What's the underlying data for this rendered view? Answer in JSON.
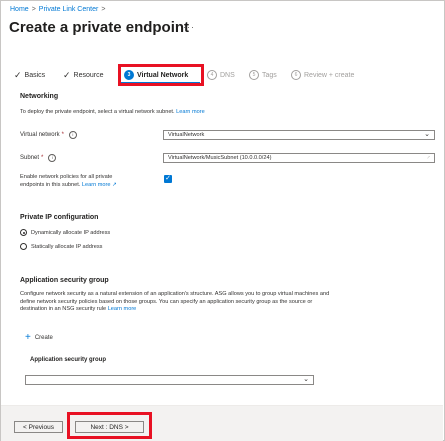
{
  "breadcrumb": {
    "home": "Home",
    "sep": ">",
    "private_link_center": "Private Link Center"
  },
  "page": {
    "title": "Create a private endpoint",
    "more": "···"
  },
  "tabs": [
    {
      "label": "Basics",
      "marker": "✓",
      "state": "done"
    },
    {
      "label": "Resource",
      "marker": "✓",
      "state": "done"
    },
    {
      "label": "Virtual Network",
      "marker": "3",
      "state": "active"
    },
    {
      "label": "DNS",
      "marker": "4",
      "state": "disabled"
    },
    {
      "label": "Tags",
      "marker": "5",
      "state": "disabled"
    },
    {
      "label": "Review + create",
      "marker": "6",
      "state": "disabled"
    }
  ],
  "networking": {
    "heading": "Networking",
    "description": "To deploy the private endpoint, select a virtual network subnet.",
    "learn_more": "Learn more",
    "vnet_label": "Virtual network",
    "vnet_value": "VirtualNetwork",
    "subnet_label": "Subnet",
    "subnet_value": "VirtualNetwork/MusicSubnet (10.0.0.0/24)",
    "policies_label_line1": "Enable network policies for all private",
    "policies_label_line2": "endpoints in this subnet.",
    "policies_learn_more": "Learn more",
    "policies_checked": true,
    "required_mark": "*",
    "info_icon": "i"
  },
  "private_ip": {
    "heading": "Private IP configuration",
    "options": [
      "Dynamically allocate IP address",
      "Statically allocate IP address"
    ],
    "selected": "Dynamically allocate IP address"
  },
  "asg": {
    "heading": "Application security group",
    "description_line1": "Configure network security as a natural extension of an application's structure. ASG allows you to group virtual machines and",
    "description_line2": "define network security policies based on those groups. You can specify an application security group as the source or",
    "description_line3": "destination in an NSG security rule",
    "learn_more": "Learn more",
    "create_label": "Create",
    "column_header": "Application security group",
    "select_value": ""
  },
  "footer": {
    "previous_label": "< Previous",
    "next_label": "Next : DNS >"
  },
  "colors": {
    "accent": "#0078d4",
    "highlight": "#e81123",
    "required": "#a4262c"
  }
}
